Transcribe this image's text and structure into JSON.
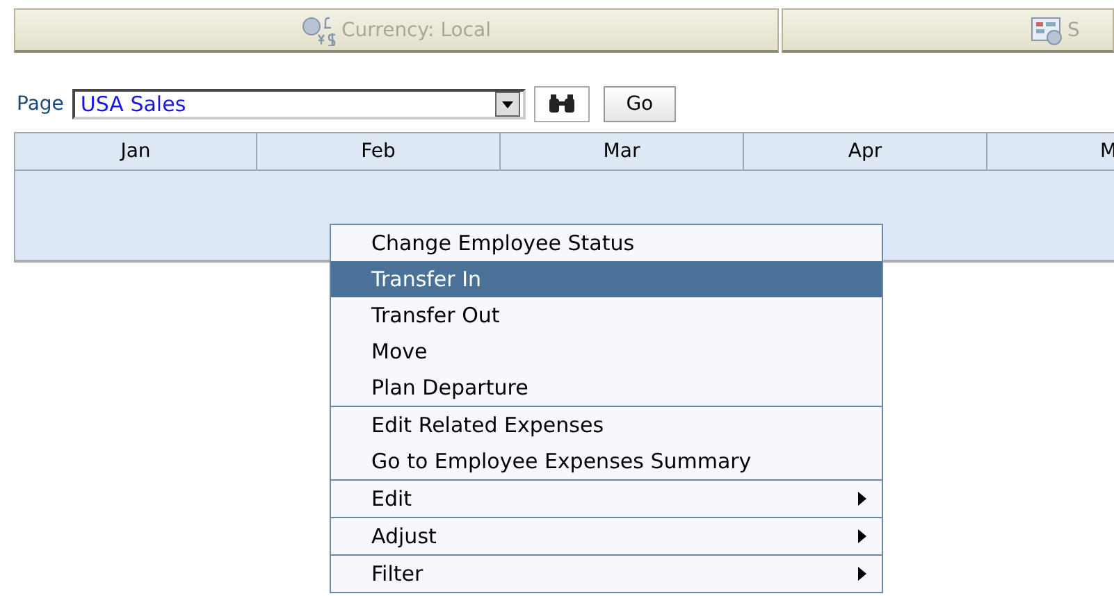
{
  "toolbar": [
    {
      "label": "Currency: Local",
      "kind": "currency"
    },
    {
      "label": "S",
      "kind": "settings"
    }
  ],
  "page_selector": {
    "label": "Page",
    "value": "USA Sales",
    "go": "Go"
  },
  "grid": {
    "columns": [
      "Jan",
      "Feb",
      "Mar",
      "Apr",
      "M"
    ]
  },
  "context_menu": {
    "groups": [
      {
        "items": [
          {
            "label": "Change Employee Status",
            "selected": false,
            "submenu": false
          },
          {
            "label": "Transfer In",
            "selected": true,
            "submenu": false
          },
          {
            "label": "Transfer Out",
            "selected": false,
            "submenu": false
          },
          {
            "label": "Move",
            "selected": false,
            "submenu": false
          },
          {
            "label": "Plan Departure",
            "selected": false,
            "submenu": false
          }
        ]
      },
      {
        "items": [
          {
            "label": "Edit Related Expenses",
            "selected": false,
            "submenu": false
          },
          {
            "label": "Go to Employee Expenses Summary",
            "selected": false,
            "submenu": false
          }
        ]
      },
      {
        "items": [
          {
            "label": "Edit",
            "selected": false,
            "submenu": true
          }
        ]
      },
      {
        "items": [
          {
            "label": "Adjust",
            "selected": false,
            "submenu": true
          }
        ]
      },
      {
        "items": [
          {
            "label": "Filter",
            "selected": false,
            "submenu": true
          }
        ]
      }
    ]
  }
}
